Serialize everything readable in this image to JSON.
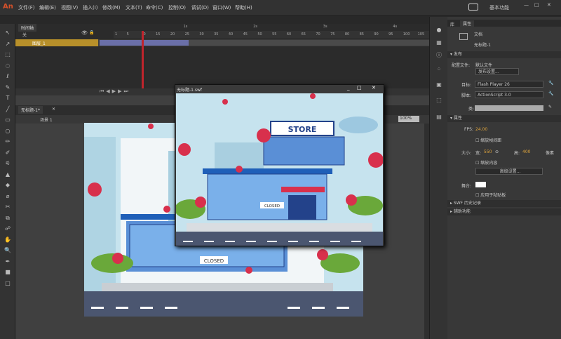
{
  "menubar": {
    "logo": "An",
    "items": [
      "文件(F)",
      "编辑(E)",
      "视图(V)",
      "插入(I)",
      "修改(M)",
      "文本(T)",
      "命令(C)",
      "控制(O)",
      "调试(D)",
      "窗口(W)",
      "帮助(H)"
    ],
    "workspace": "基本功能"
  },
  "timeline": {
    "tab": "时间轴",
    "layer_header": "关",
    "layer_name": "图层_1",
    "ticks": [
      "1",
      "5",
      "10",
      "15",
      "20",
      "25",
      "30",
      "35",
      "40",
      "45",
      "50",
      "55",
      "60",
      "65",
      "70",
      "75",
      "80",
      "85",
      "90",
      "95",
      "100",
      "105"
    ],
    "seconds": [
      "1s",
      "2s",
      "3s",
      "4s"
    ],
    "playhead_frame": "13"
  },
  "document": {
    "tab": "无标题-1*",
    "scene": "场景 1",
    "zoom": "100%"
  },
  "swf_window": {
    "title": "无标题-1.swf"
  },
  "artwork": {
    "store_sign": "STORE",
    "closed_sign": "CLOSED"
  },
  "properties": {
    "tabs": [
      "库",
      "属性"
    ],
    "doc_type": "文档",
    "doc_name": "无标题-1",
    "publish_section": "发布",
    "profile_label": "配置文件:",
    "profile_value": "默认文件",
    "publish_settings": "发布设置...",
    "target_label": "目标:",
    "target_value": "Flash Player 26",
    "script_label": "脚本:",
    "script_value": "ActionScript 3.0",
    "class_label": "类:",
    "attr_section": "属性",
    "fps_label": "FPS:",
    "fps_value": "24.00",
    "scale_spans": "缩放帧间距",
    "size_label": "大小:",
    "width_label": "宽:",
    "width_value": "550",
    "height_label": "高:",
    "height_value": "400",
    "unit": "像素",
    "scale_content": "缩放内容",
    "advanced": "高级设置...",
    "stage_label": "舞台:",
    "apply_paste": "应用于粘贴板",
    "history": "SWF 历史记录",
    "accessibility": "辅助功能"
  },
  "colors": {
    "stage_color": "#ffffff",
    "accent": "#d5512a"
  }
}
